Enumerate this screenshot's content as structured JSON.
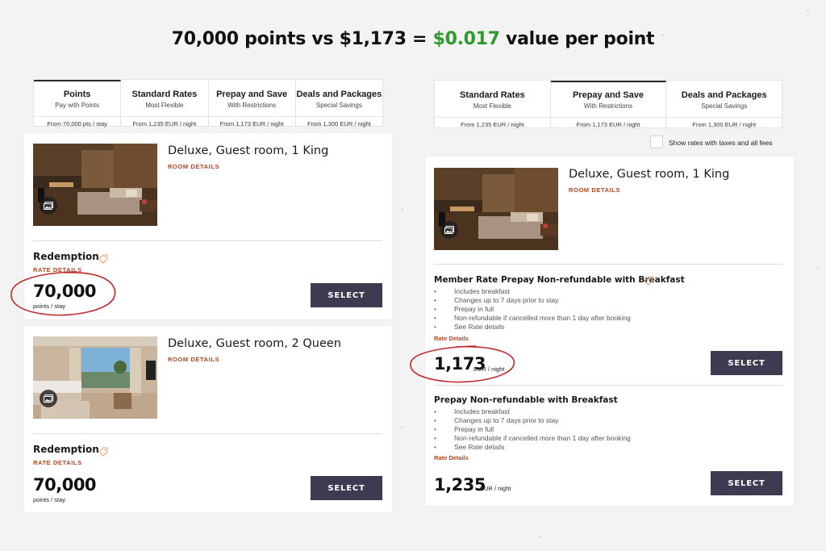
{
  "headline": {
    "pre": "70,000 points vs $1,173 = ",
    "highlight": "$0.017",
    "post": " value per point"
  },
  "colors": {
    "highlight_green": "#2e9a2b",
    "accent_rust": "#b4431c",
    "button_bg": "#3e3a52",
    "annotation_red": "#c0292c"
  },
  "left": {
    "tabs": [
      {
        "title": "Points",
        "sub": "Pay with Points",
        "price": "From 70,000 pts / stay",
        "active": true
      },
      {
        "title": "Standard Rates",
        "sub": "Most Flexible",
        "price": "From 1,235 EUR / night",
        "active": false
      },
      {
        "title": "Prepay and Save",
        "sub": "With Restrictions",
        "price": "From 1,173 EUR / night",
        "active": false
      },
      {
        "title": "Deals and Packages",
        "sub": "Special Savings",
        "price": "From 1,300 EUR / night",
        "active": false
      }
    ],
    "rooms": [
      {
        "name": "Deluxe, Guest room, 1 King",
        "details_label": "ROOM DETAILS",
        "rate_title": "Redemption",
        "rate_details_label": "RATE DETAILS",
        "price": "70,000",
        "unit": "points / stay",
        "button": "SELECT",
        "image_icon": "gallery-icon"
      },
      {
        "name": "Deluxe, Guest room, 2 Queen",
        "details_label": "ROOM DETAILS",
        "rate_title": "Redemption",
        "rate_details_label": "RATE DETAILS",
        "price": "70,000",
        "unit": "points / stay",
        "button": "SELECT",
        "image_icon": "gallery-icon"
      }
    ]
  },
  "right": {
    "tabs": [
      {
        "title": "Standard Rates",
        "sub": "Most Flexible",
        "price": "From 1,235 EUR / night",
        "active": false
      },
      {
        "title": "Prepay and Save",
        "sub": "With Restrictions",
        "price": "From 1,173 EUR / night",
        "active": true
      },
      {
        "title": "Deals and Packages",
        "sub": "Special Savings",
        "price": "From 1,300 EUR / night",
        "active": false
      }
    ],
    "taxes_checkbox_label": "Show rates with taxes and all fees",
    "room": {
      "name": "Deluxe, Guest room, 1 King",
      "details_label": "ROOM DETAILS"
    },
    "rates": [
      {
        "title": "Member Rate Prepay Non-refundable with Breakfast",
        "bullets": [
          "Includes breakfast",
          "Changes up to 7 days prior to stay",
          "Prepay in full",
          "Non-refundable if cancelled more than 1 day after booking",
          "See Rate details"
        ],
        "link": "Rate Details",
        "price": "1,173",
        "unit": "EUR / night",
        "button": "SELECT"
      },
      {
        "title": "Prepay Non-refundable with Breakfast",
        "bullets": [
          "Includes breakfast",
          "Changes up to 7 days prior to stay",
          "Prepay in full",
          "Non-refundable if cancelled more than 1 day after booking",
          "See Rate details"
        ],
        "link": "Rate Details",
        "price": "1,235",
        "unit": "EUR / night",
        "button": "SELECT"
      }
    ]
  }
}
